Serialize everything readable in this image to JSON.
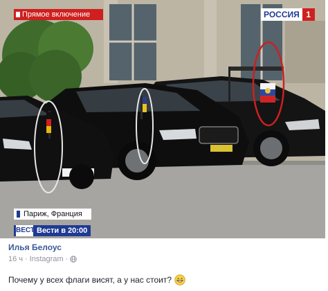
{
  "video": {
    "live_banner": "Прямое включение",
    "channel_name": "РОССИЯ",
    "channel_number": "1",
    "location": "Париж, Франция",
    "news_logo": "ВЕСТИ",
    "news_time": "Вести в 20:00"
  },
  "post": {
    "author": "Илья Белоус",
    "time": "16 ч",
    "separator": "·",
    "source": "Instagram",
    "privacy_icon": "globe-icon",
    "text": "Почему у всех флаги висят, а у нас стоит?",
    "emoji": "grinning-face-icon"
  },
  "colors": {
    "author_link": "#3b5998",
    "meta_text": "#90949c",
    "channel_red": "#d01f1f",
    "channel_blue": "#1f3a93",
    "annotation_ring": "#cc2020"
  }
}
